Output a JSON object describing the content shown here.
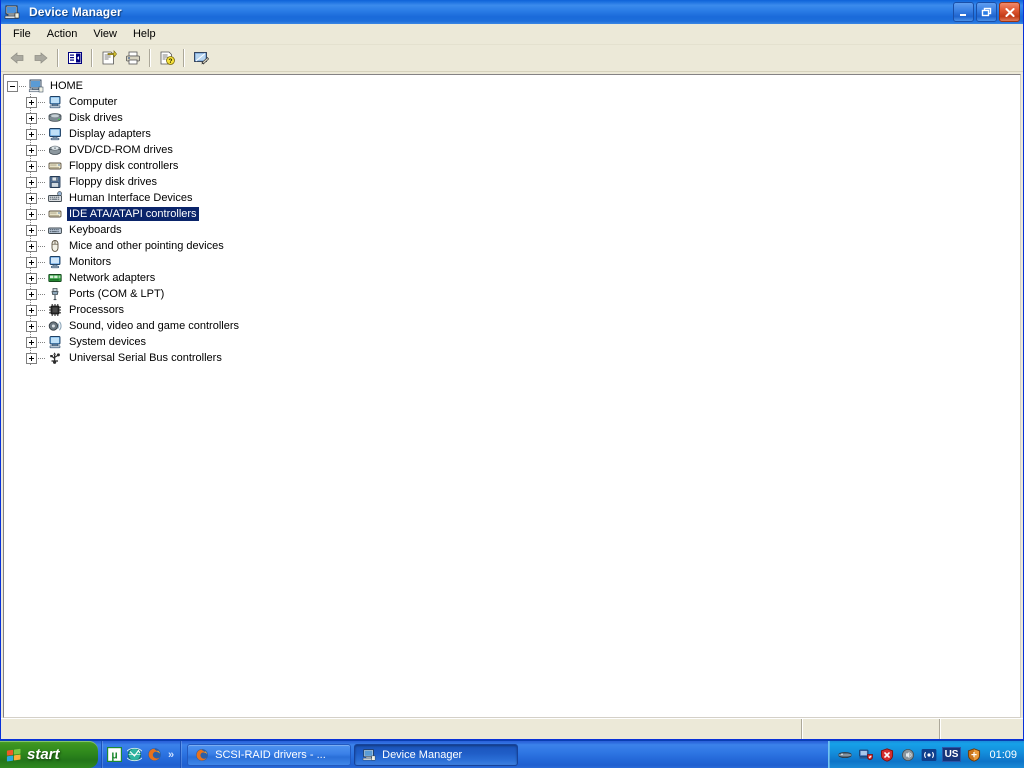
{
  "window": {
    "title": "Device Manager",
    "icon": "device-manager-icon",
    "buttons": {
      "minimize": "Minimize",
      "restore": "Restore",
      "close": "Close"
    }
  },
  "menubar": {
    "items": [
      {
        "label": "File"
      },
      {
        "label": "Action"
      },
      {
        "label": "View"
      },
      {
        "label": "Help"
      }
    ]
  },
  "toolbar": {
    "buttons": [
      {
        "name": "back-arrow-icon",
        "tooltip": "Back",
        "enabled": false
      },
      {
        "name": "forward-arrow-icon",
        "tooltip": "Forward",
        "enabled": false
      },
      {
        "name": "show-hide-console-tree-icon",
        "tooltip": "Show/Hide Console Tree",
        "enabled": true
      },
      {
        "name": "properties-icon",
        "tooltip": "Properties",
        "enabled": true
      },
      {
        "name": "print-icon",
        "tooltip": "Print",
        "enabled": true
      },
      {
        "name": "help-properties-icon",
        "tooltip": "Help",
        "enabled": true
      },
      {
        "name": "scan-hardware-changes-icon",
        "tooltip": "Scan for hardware changes",
        "enabled": true
      }
    ]
  },
  "tree": {
    "root": {
      "label": "HOME",
      "icon": "computer-icon",
      "expander": "minus"
    },
    "items": [
      {
        "label": "Computer",
        "icon": "computer-node-icon",
        "expander": "plus",
        "selected": false
      },
      {
        "label": "Disk drives",
        "icon": "disk-drive-icon",
        "expander": "plus",
        "selected": false
      },
      {
        "label": "Display adapters",
        "icon": "display-adapter-icon",
        "expander": "plus",
        "selected": false
      },
      {
        "label": "DVD/CD-ROM drives",
        "icon": "cdrom-icon",
        "expander": "plus",
        "selected": false
      },
      {
        "label": "Floppy disk controllers",
        "icon": "floppy-controller-icon",
        "expander": "plus",
        "selected": false
      },
      {
        "label": "Floppy disk drives",
        "icon": "floppy-drive-icon",
        "expander": "plus",
        "selected": false
      },
      {
        "label": "Human Interface Devices",
        "icon": "hid-icon",
        "expander": "plus",
        "selected": false
      },
      {
        "label": "IDE ATA/ATAPI controllers",
        "icon": "ide-controller-icon",
        "expander": "plus",
        "selected": true
      },
      {
        "label": "Keyboards",
        "icon": "keyboard-icon",
        "expander": "plus",
        "selected": false
      },
      {
        "label": "Mice and other pointing devices",
        "icon": "mouse-icon",
        "expander": "plus",
        "selected": false
      },
      {
        "label": "Monitors",
        "icon": "monitor-icon",
        "expander": "plus",
        "selected": false
      },
      {
        "label": "Network adapters",
        "icon": "network-adapter-icon",
        "expander": "plus",
        "selected": false
      },
      {
        "label": "Ports (COM & LPT)",
        "icon": "port-icon",
        "expander": "plus",
        "selected": false
      },
      {
        "label": "Processors",
        "icon": "processor-icon",
        "expander": "plus",
        "selected": false
      },
      {
        "label": "Sound, video and game controllers",
        "icon": "sound-controller-icon",
        "expander": "plus",
        "selected": false
      },
      {
        "label": "System devices",
        "icon": "system-device-icon",
        "expander": "plus",
        "selected": false
      },
      {
        "label": "Universal Serial Bus controllers",
        "icon": "usb-controller-icon",
        "expander": "plus",
        "selected": false
      }
    ]
  },
  "statusbar": {
    "panels": [
      {
        "text": ""
      },
      {
        "text": ""
      },
      {
        "text": ""
      }
    ]
  },
  "taskbar": {
    "start_label": "start",
    "start_icon": "windows-flag-icon",
    "quicklaunch": [
      {
        "name": "utorrent-icon"
      },
      {
        "name": "teal-globe-icon"
      },
      {
        "name": "firefox-icon"
      }
    ],
    "quicklaunch_overflow": "»",
    "buttons": [
      {
        "label": "SCSI-RAID drivers - ...",
        "icon": "firefox-icon",
        "active": false
      },
      {
        "label": "Device Manager",
        "icon": "device-manager-icon",
        "active": true
      }
    ],
    "tray": {
      "icons": [
        {
          "name": "network-connection-icon"
        },
        {
          "name": "network-shield-icon"
        },
        {
          "name": "security-alert-icon"
        },
        {
          "name": "volume-icon"
        },
        {
          "name": "wireless-icon"
        }
      ],
      "language": "US",
      "shield_icon": "security-center-icon",
      "clock": "01:09"
    }
  },
  "colors": {
    "titlebar_blue": "#1c71e0",
    "selection_blue": "#0a246a",
    "window_face": "#ece9d8",
    "taskbar_blue": "#2f77e4",
    "start_green": "#3d9421",
    "desktop": "#5b8bd0"
  }
}
